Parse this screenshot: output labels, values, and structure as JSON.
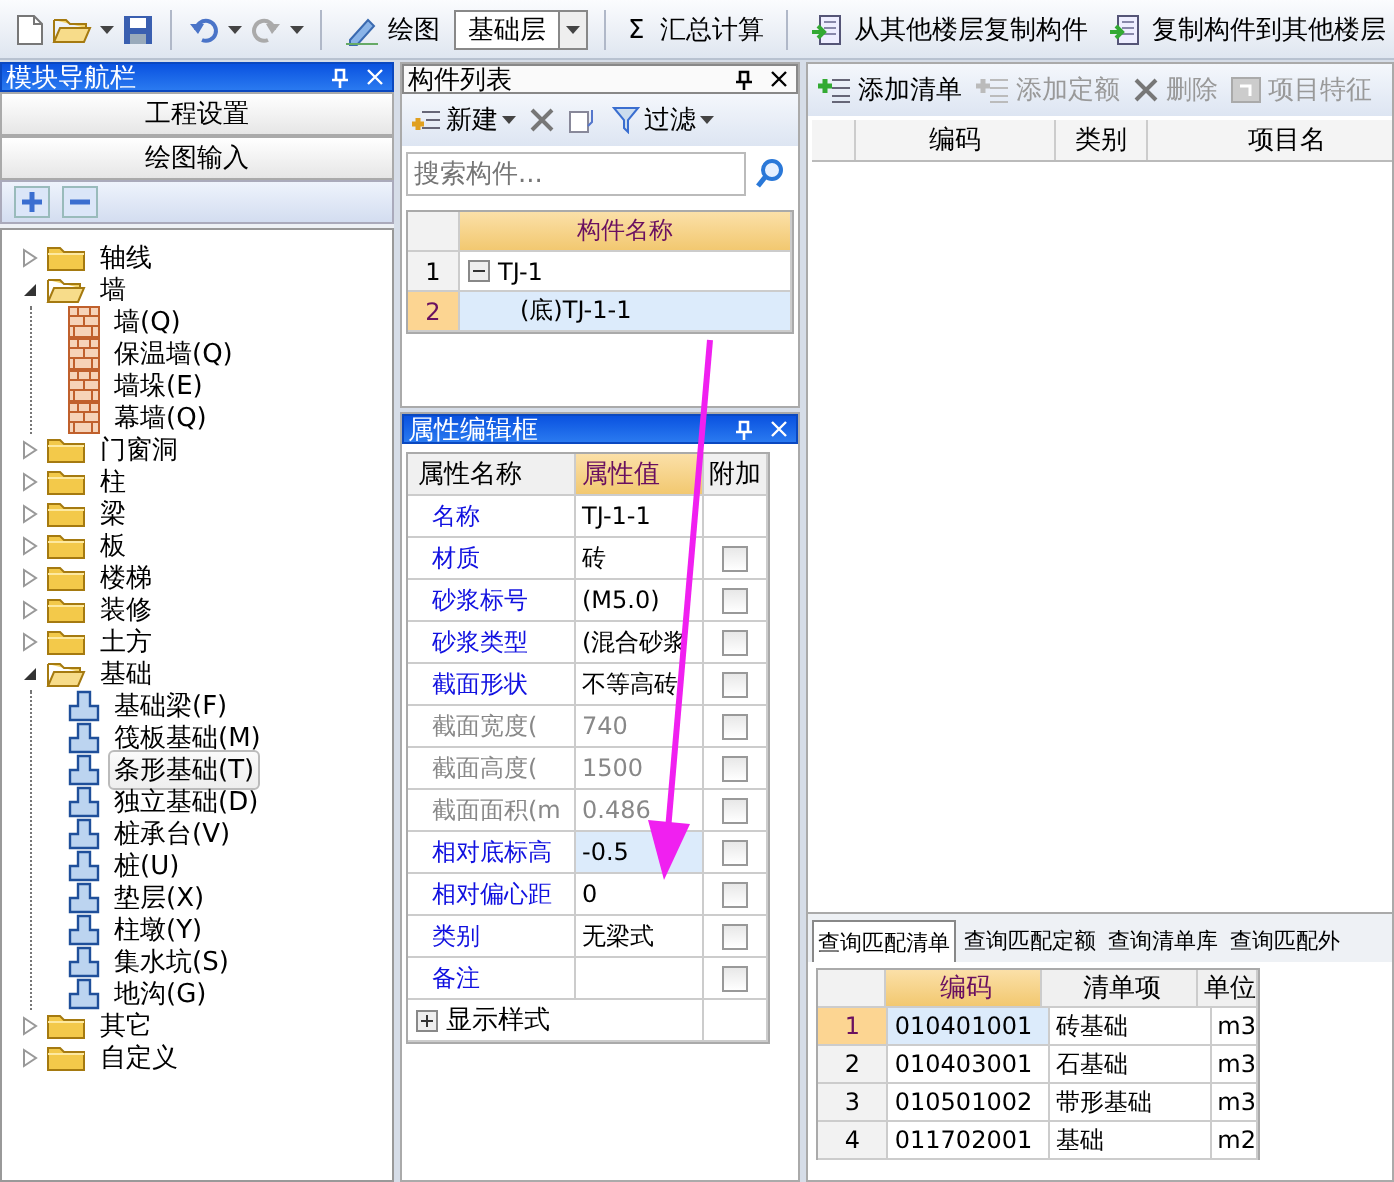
{
  "toolbar": {
    "draw_label": "绘图",
    "layer": "基础层",
    "sum_symbol": "Σ",
    "sum_label": "汇总计算",
    "copy_from": "从其他楼层复制构件",
    "copy_to": "复制构件到其他楼层"
  },
  "nav": {
    "title": "模块导航栏",
    "active": true,
    "buttons": [
      "工程设置",
      "绘图输入"
    ],
    "tree": [
      {
        "label": "轴线",
        "expanded": false,
        "selected": false
      },
      {
        "label": "墙",
        "expanded": true,
        "selected": false,
        "children": [
          {
            "label": "墙(Q)",
            "kind": "wall",
            "selected": false
          },
          {
            "label": "保温墙(Q)",
            "kind": "wall",
            "selected": false
          },
          {
            "label": "墙垛(E)",
            "kind": "wall",
            "selected": false
          },
          {
            "label": "幕墙(Q)",
            "kind": "wall",
            "selected": false
          }
        ]
      },
      {
        "label": "门窗洞",
        "expanded": false,
        "selected": false
      },
      {
        "label": "柱",
        "expanded": false,
        "selected": false
      },
      {
        "label": "梁",
        "expanded": false,
        "selected": false
      },
      {
        "label": "板",
        "expanded": false,
        "selected": false
      },
      {
        "label": "楼梯",
        "expanded": false,
        "selected": false
      },
      {
        "label": "装修",
        "expanded": false,
        "selected": false
      },
      {
        "label": "土方",
        "expanded": false,
        "selected": false
      },
      {
        "label": "基础",
        "expanded": true,
        "selected": false,
        "children": [
          {
            "label": "基础梁(F)",
            "kind": "foundation",
            "selected": false
          },
          {
            "label": "筏板基础(M)",
            "kind": "foundation",
            "selected": false
          },
          {
            "label": "条形基础(T)",
            "kind": "foundation",
            "selected": true
          },
          {
            "label": "独立基础(D)",
            "kind": "foundation",
            "selected": false
          },
          {
            "label": "桩承台(V)",
            "kind": "foundation",
            "selected": false
          },
          {
            "label": "桩(U)",
            "kind": "foundation",
            "selected": false
          },
          {
            "label": "垫层(X)",
            "kind": "foundation",
            "selected": false
          },
          {
            "label": "柱墩(Y)",
            "kind": "foundation",
            "selected": false
          },
          {
            "label": "集水坑(S)",
            "kind": "foundation",
            "selected": false
          },
          {
            "label": "地沟(G)",
            "kind": "foundation",
            "selected": false
          }
        ]
      },
      {
        "label": "其它",
        "expanded": false,
        "selected": false
      },
      {
        "label": "自定义",
        "expanded": false,
        "selected": false
      }
    ]
  },
  "components": {
    "title": "构件列表",
    "active": false,
    "new_label": "新建",
    "filter_label": "过滤",
    "search": {
      "placeholder": "搜索构件..."
    },
    "columns": [
      {
        "label": "构件名称",
        "active": true
      }
    ],
    "rows": [
      {
        "num": "1",
        "name": "TJ-1",
        "expanded": true,
        "selected": false,
        "children": [
          {
            "num": "2",
            "name": "(底)TJ-1-1",
            "selected": true
          }
        ]
      }
    ]
  },
  "properties": {
    "title": "属性编辑框",
    "active": true,
    "columns": [
      {
        "label": "属性名称",
        "active": false
      },
      {
        "label": "属性值",
        "active": true
      },
      {
        "label": "附加",
        "active": false
      }
    ],
    "rows": [
      {
        "kind": "field",
        "name": "名称",
        "value": "TJ-1-1",
        "disabled": false,
        "selected": false
      },
      {
        "kind": "check",
        "name": "材质",
        "value": "砖",
        "disabled": false,
        "selected": false,
        "checked": false
      },
      {
        "kind": "check",
        "name": "砂浆标号",
        "value": "(M5.0)",
        "disabled": false,
        "selected": false,
        "checked": false
      },
      {
        "kind": "check",
        "name": "砂浆类型",
        "value": "(混合砂浆",
        "disabled": false,
        "selected": false,
        "checked": false
      },
      {
        "kind": "check",
        "name": "截面形状",
        "value": "不等高砖",
        "disabled": false,
        "selected": false,
        "checked": false
      },
      {
        "kind": "check",
        "name": "截面宽度(",
        "value": "740",
        "disabled": true,
        "selected": false,
        "checked": false
      },
      {
        "kind": "check",
        "name": "截面高度(",
        "value": "1500",
        "disabled": true,
        "selected": false,
        "checked": false
      },
      {
        "kind": "check",
        "name": "截面面积(m",
        "value": "0.486",
        "disabled": true,
        "selected": false,
        "checked": false
      },
      {
        "kind": "check",
        "name": "相对底标高",
        "value": "-0.5",
        "disabled": false,
        "selected": true,
        "checked": false
      },
      {
        "kind": "check",
        "name": "相对偏心距",
        "value": "0",
        "disabled": false,
        "selected": false,
        "checked": false
      },
      {
        "kind": "check",
        "name": "类别",
        "value": "无梁式",
        "disabled": false,
        "selected": false,
        "checked": false
      },
      {
        "kind": "check",
        "name": "备注",
        "value": "",
        "disabled": false,
        "selected": false,
        "checked": false
      },
      {
        "kind": "group",
        "name": "显示样式",
        "expanded": false
      }
    ]
  },
  "list": {
    "toolbar": [
      {
        "kind": "add",
        "label": "添加清单",
        "disabled": false
      },
      {
        "kind": "add",
        "label": "添加定额",
        "disabled": true
      },
      {
        "kind": "delete",
        "label": "删除",
        "disabled": true
      },
      {
        "kind": "feature",
        "label": "项目特征",
        "disabled": true
      }
    ],
    "columns": [
      {
        "label": "编码",
        "active": false
      },
      {
        "label": "类别",
        "active": false
      },
      {
        "label": "项目名",
        "active": false
      }
    ],
    "tabs": [
      {
        "label": "查询匹配清单",
        "selected": true
      },
      {
        "label": "查询匹配定额",
        "selected": false
      },
      {
        "label": "查询清单库",
        "selected": false
      },
      {
        "label": "查询匹配外",
        "selected": false
      }
    ],
    "match": {
      "columns": [
        {
          "label": "编码",
          "active": true
        },
        {
          "label": "清单项",
          "active": false
        },
        {
          "label": "单位",
          "active": false
        }
      ],
      "rows": [
        {
          "num": "1",
          "code": "010401001",
          "item": "砖基础",
          "unit": "m3",
          "selected": true
        },
        {
          "num": "2",
          "code": "010403001",
          "item": "石基础",
          "unit": "m3",
          "selected": false
        },
        {
          "num": "3",
          "code": "010501002",
          "item": "带形基础",
          "unit": "m3",
          "selected": false
        },
        {
          "num": "4",
          "code": "011702001",
          "item": "基础",
          "unit": "m2",
          "selected": false
        }
      ]
    }
  }
}
